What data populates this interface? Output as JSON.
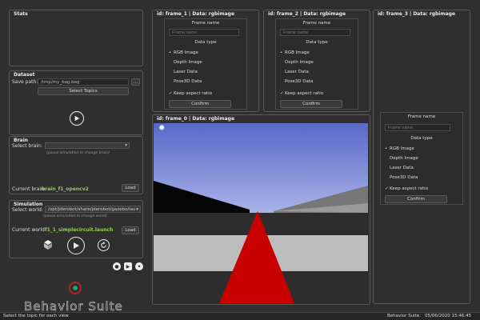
{
  "stats": {
    "title": "Stats"
  },
  "dataset": {
    "title": "Dataset",
    "save_path_label": "Save path:",
    "save_path_value": "/tmp/my_bag.bag",
    "browse_label": "...",
    "select_topics_label": "Select Topics",
    "play_icon": "play-icon"
  },
  "brain": {
    "title": "Brain",
    "select_label": "Select brain:",
    "select_value": "",
    "hint": "(pause simulation to change brain)",
    "current_label": "Current brain:",
    "current_value": "brain_f1_opencv2",
    "load_label": "Load"
  },
  "simulation": {
    "title": "Simulation",
    "select_label": "Select world:",
    "select_value": "/opt/jderobot/share/jderobot/gazebo/lau",
    "hint": "(pause simulation to change world)",
    "current_label": "Current world:",
    "current_value": "f1_1_simplecircuit.launch",
    "load_label": "Load"
  },
  "frames": {
    "frame_1": {
      "title": "id: frame_1 | Data: rgbimage"
    },
    "frame_2": {
      "title": "id: frame_2 | Data: rgbimage"
    },
    "frame_3": {
      "title": "id: frame_3 | Data: rgbimage"
    },
    "frame_0": {
      "title": "id: frame_0 | Data: rgbimage"
    }
  },
  "frame_config": {
    "frame_name_label": "Frame name",
    "frame_name_placeholder": "Frame name",
    "data_type_label": "Data type",
    "options": [
      "RGB Image",
      "Depth Image",
      "Laser Data",
      "Pose3D Data"
    ],
    "selected": "RGB Image",
    "keep_aspect_label": "Keep aspect ratio",
    "confirm_label": "Confirm"
  },
  "logo": {
    "text": "Behavior Suite"
  },
  "social": {
    "github": "github-icon",
    "youtube": "youtube-icon",
    "twitter": "twitter-icon"
  },
  "status_bar": {
    "message": "Select the topic for each view",
    "app_name": "Behavior Suite",
    "datetime": "05/06/2020 15:46:45"
  },
  "colors": {
    "background": "#2f2f2f",
    "accent_green": "#8fcf5a",
    "track_red": "#c80000",
    "sky_blue": "#6f84d4"
  }
}
